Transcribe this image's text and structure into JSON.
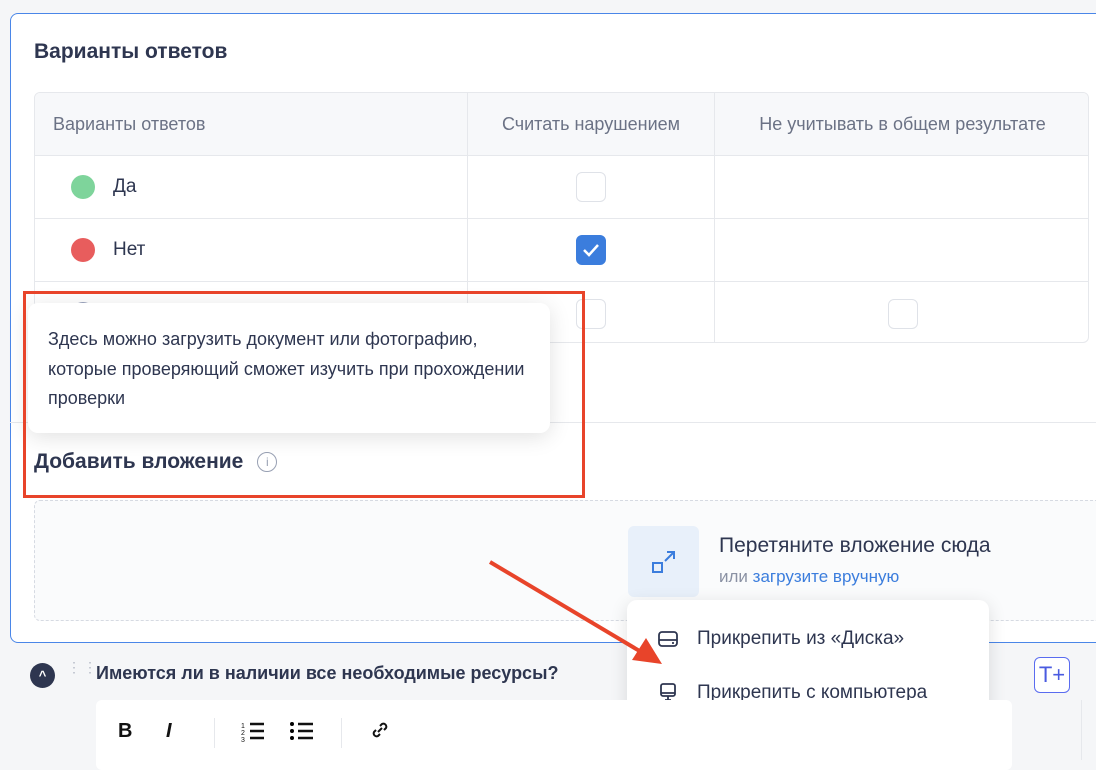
{
  "section_title": "Варианты ответов",
  "table": {
    "headers": [
      "Варианты ответов",
      "Считать нарушением",
      "Не учитывать в общем результате"
    ],
    "rows": [
      {
        "label": "Да",
        "color": "#7ed49b",
        "violation": false
      },
      {
        "label": "Нет",
        "color": "#e85d5d",
        "violation": true
      },
      {
        "label": "",
        "color": "#9aa3bd",
        "violation": false,
        "exclude": false
      }
    ]
  },
  "attachment": {
    "title": "Добавить вложение",
    "tooltip": "Здесь можно загрузить документ или фотографию, которые проверяющий сможет изучить при прохождении проверки",
    "drop_text": "Перетяните вложение сюда",
    "or": "или",
    "upload_link": "загрузите вручную"
  },
  "menu": {
    "items": [
      "Прикрепить из «Диска»",
      "Прикрепить с компьютера"
    ]
  },
  "question": {
    "text": "Имеются ли в наличии все необходимые ресурсы?"
  },
  "toolbar": {
    "bold": "B",
    "italic": "I",
    "tplus": "T+"
  }
}
